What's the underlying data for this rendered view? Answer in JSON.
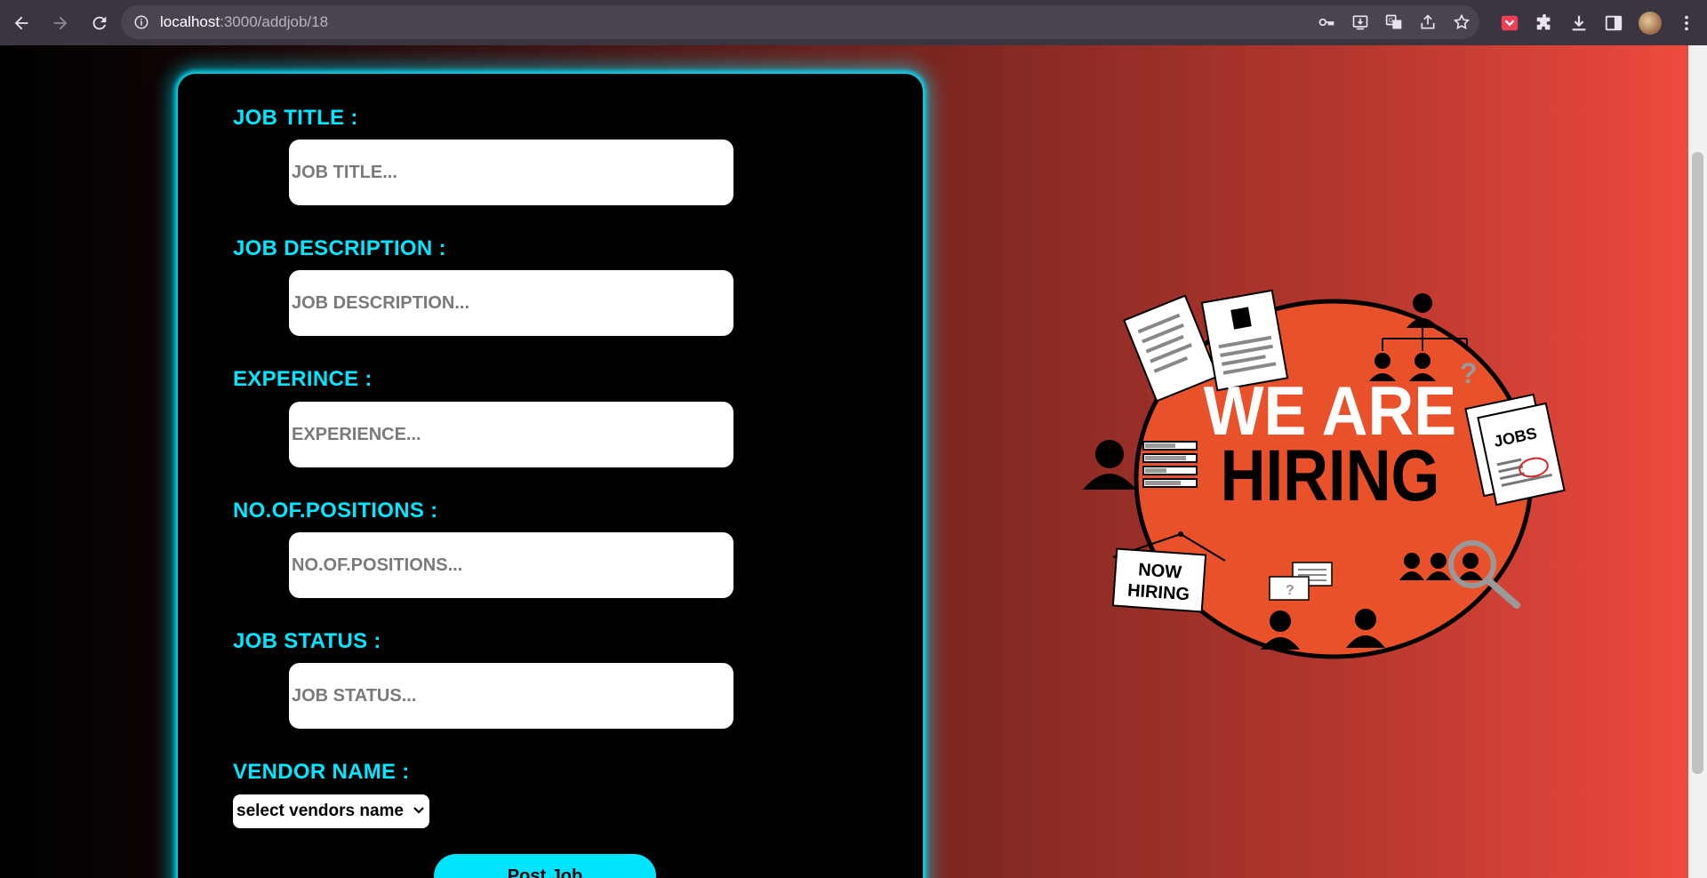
{
  "browser": {
    "url_host": "localhost",
    "url_path": ":3000/addjob/18"
  },
  "form": {
    "fields": [
      {
        "label": "JOB TITLE :",
        "placeholder": "JOB TITLE...",
        "value": ""
      },
      {
        "label": "JOB DESCRIPTION :",
        "placeholder": "JOB DESCRIPTION...",
        "value": ""
      },
      {
        "label": "EXPERINCE :",
        "placeholder": "EXPERIENCE...",
        "value": ""
      },
      {
        "label": "NO.OF.POSITIONS :",
        "placeholder": "NO.OF.POSITIONS...",
        "value": ""
      },
      {
        "label": "JOB STATUS :",
        "placeholder": "JOB STATUS...",
        "value": ""
      }
    ],
    "vendor": {
      "label": "VENDOR NAME :",
      "selected": "select vendors name"
    },
    "submit_label": "Post Job"
  },
  "illustration": {
    "headline_line1": "WE ARE",
    "headline_line2": "HIRING",
    "jobs_label": "JOBS",
    "sign_line1": "NOW",
    "sign_line2": "HIRING"
  },
  "colors": {
    "accent": "#00e7ff",
    "card_bg": "#000000",
    "circle_fill": "#e8512a"
  }
}
